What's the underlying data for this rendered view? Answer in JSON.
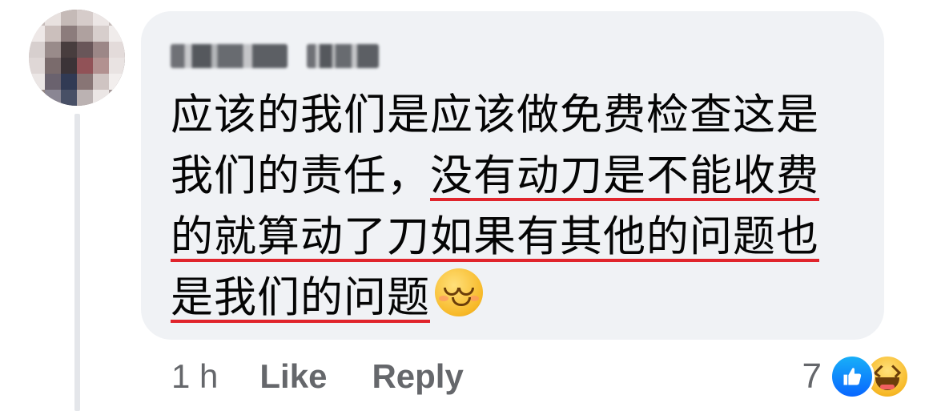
{
  "comment": {
    "author_name": "",
    "text_segments": [
      {
        "text": "应该的我们是应该做免费检查这是我们的责任，",
        "underlined": false
      },
      {
        "text": "没有动刀是不能收费的就算动了刀如果有其他的问题也是我们的问题",
        "underlined": true
      }
    ],
    "emoji": "relieved-face-emoji",
    "timestamp": "1 h",
    "like_label": "Like",
    "reply_label": "Reply",
    "reaction_count": "7",
    "reactions": [
      "like-reaction-icon",
      "haha-reaction-icon"
    ],
    "colors": {
      "bubble": "#f0f2f5",
      "underline": "#e0242c",
      "like_blue": "#0866ff",
      "meta_text": "#65676b"
    }
  }
}
